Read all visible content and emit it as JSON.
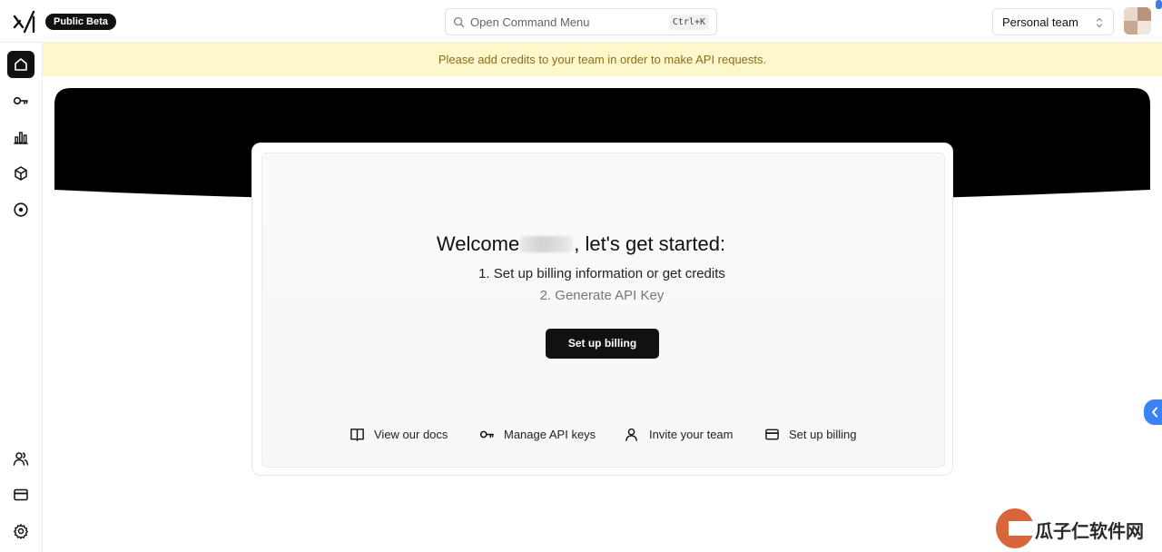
{
  "header": {
    "badge": "Public Beta",
    "command_menu": {
      "placeholder": "Open Command Menu",
      "shortcut": "Ctrl+K"
    },
    "team_selector": {
      "value": "Personal team"
    }
  },
  "sidebar": {
    "top_items": [
      {
        "icon": "home-icon",
        "active": true
      },
      {
        "icon": "key-icon",
        "active": false
      },
      {
        "icon": "bar-chart-icon",
        "active": false
      },
      {
        "icon": "cube-icon",
        "active": false
      },
      {
        "icon": "playground-icon",
        "active": false
      }
    ],
    "bottom_items": [
      {
        "icon": "users-icon"
      },
      {
        "icon": "credit-card-icon"
      },
      {
        "icon": "gear-icon"
      }
    ]
  },
  "banner": {
    "text": "Please add credits to your team in order to make API requests."
  },
  "main": {
    "welcome_prefix": "Welcome",
    "welcome_suffix": ", let's get started:",
    "steps": [
      "1. Set up billing information or get credits",
      "2. Generate API Key"
    ],
    "cta_label": "Set up billing",
    "links": [
      {
        "icon": "book-icon",
        "label": "View our docs"
      },
      {
        "icon": "key-icon",
        "label": "Manage API keys"
      },
      {
        "icon": "user-icon",
        "label": "Invite your team"
      },
      {
        "icon": "credit-card-icon",
        "label": "Set up billing"
      }
    ]
  },
  "watermark": {
    "text": "瓜子仁软件网"
  },
  "colors": {
    "banner_bg": "#fdf7cc",
    "banner_text": "#8d6e1a",
    "primary": "#111111",
    "side_tab": "#3b82f6"
  }
}
